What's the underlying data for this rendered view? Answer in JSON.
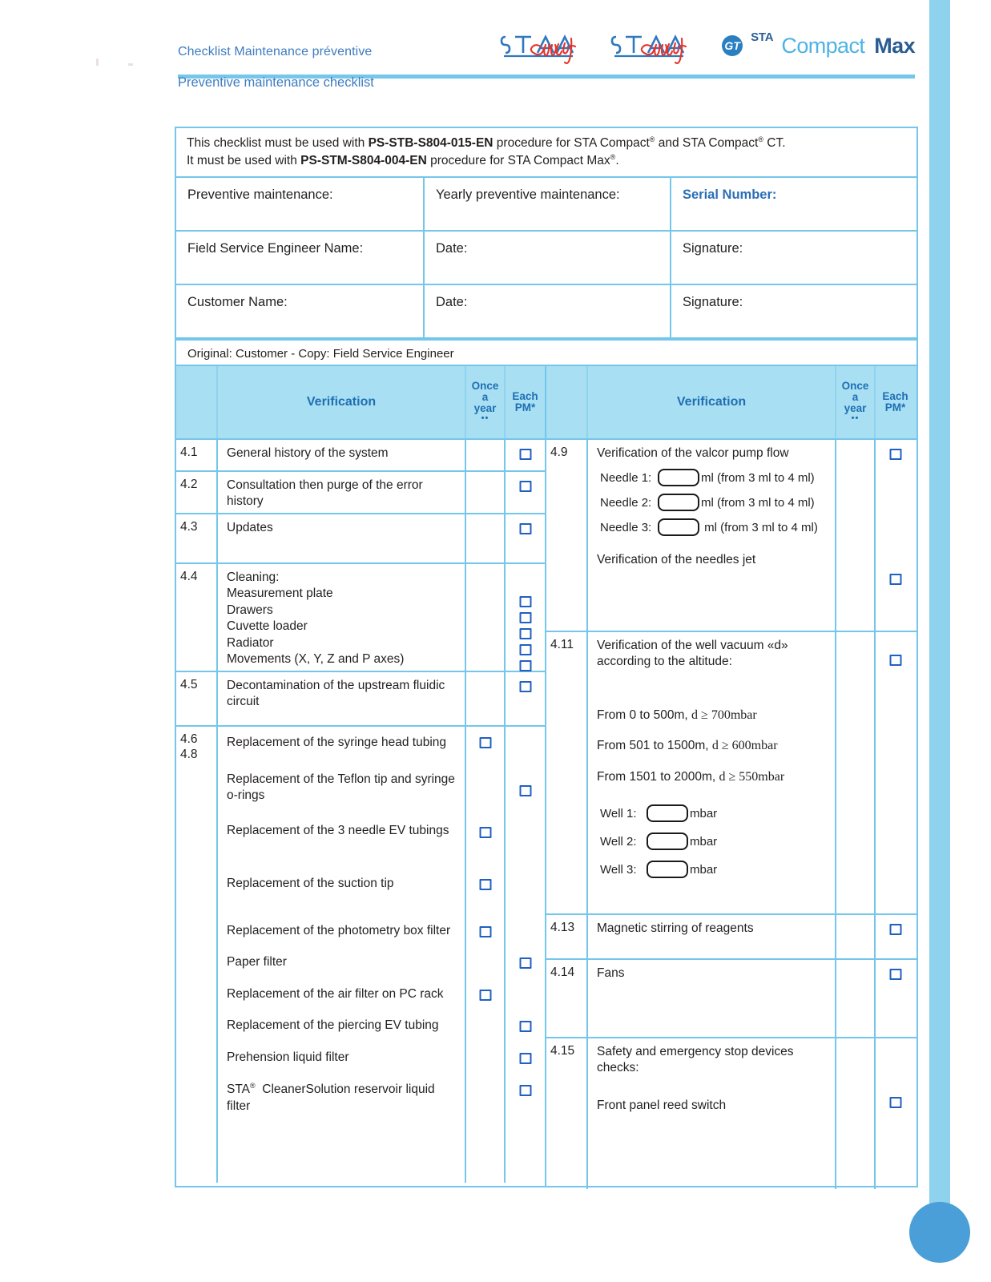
{
  "document": {
    "header": {
      "title_fr": "Checklist Maintenance préventive",
      "title_en": "Preventive maintenance checklist",
      "logo": {
        "mark_text": "STA",
        "mark_script": "Compact",
        "badge_text": "GT",
        "brand_sta": "STA",
        "brand_compact": "Compact",
        "brand_max": "Max"
      }
    },
    "intro": {
      "line1_pre": "This checklist must be used with ",
      "line1_code": "PS-STB-S804-015-EN",
      "line1_mid": " procedure for STA Compact",
      "line1_post": " and STA Compact",
      "line1_end": " CT.",
      "line2_pre": "It must be used with ",
      "line2_code": "PS-STM-S804-004-EN",
      "line2_mid": " procedure for STA Compact Max",
      "line2_end": "."
    },
    "info_table": {
      "rows": [
        {
          "c1": "Preventive maintenance:",
          "c2": "Yearly preventive maintenance:",
          "c3": "Serial Number:",
          "c3_accent": true
        },
        {
          "c1": "Field Service Engineer Name:",
          "c2": "Date:",
          "c3": "Signature:",
          "c3_accent": false
        },
        {
          "c1": "Customer Name:",
          "c2": "Date:",
          "c3": "Signature:",
          "c3_accent": false
        }
      ],
      "footnote": "Original: Customer - Copy: Field Service Engineer"
    },
    "checklist": {
      "columns": {
        "verification": "Verification",
        "once_a_year": {
          "l1": "Once",
          "l2": "a",
          "l3": "year",
          "l4": "••"
        },
        "each_pm": {
          "l1": "Each",
          "l2": "PM*"
        }
      },
      "left_rows": [
        {
          "num": "4.1",
          "lines": [
            "General history of the system"
          ],
          "checks_pm": 1,
          "checks_year": 0
        },
        {
          "num": "4.2",
          "lines": [
            "Consultation then purge of the error",
            "history"
          ],
          "checks_pm": 1,
          "checks_year": 0
        },
        {
          "num": "4.3",
          "lines": [
            "Updates"
          ],
          "checks_pm": 1,
          "checks_year": 0
        },
        {
          "num": "4.4",
          "lines": [
            "Cleaning:",
            "Measurement plate",
            "Drawers",
            "Cuvette loader",
            "Radiator",
            "Movements (X, Y, Z and P axes)"
          ],
          "checks_pm": 5,
          "checks_year": 0
        },
        {
          "num": "4.5",
          "lines": [
            "Decontamination of the upstream fluidic",
            "circuit"
          ],
          "checks_pm": 1,
          "checks_year": 0
        },
        {
          "num": "4.6 / 4.8",
          "num_l1": "4.6",
          "num_l2": "4.8",
          "items": [
            {
              "text": "Replacement of the syringe head tubing",
              "col": "year"
            },
            {
              "text": "Replacement of the Teflon tip and syringe o-rings",
              "col": "pm"
            },
            {
              "text": "Replacement of the 3 needle EV tubings",
              "col": "year"
            },
            {
              "text": "Replacement of the suction tip",
              "col": "year"
            },
            {
              "text": "Replacement of the photometry box filter",
              "col": "year"
            },
            {
              "text": "Paper filter",
              "col": "pm"
            },
            {
              "text": "Replacement of the air filter on PC rack",
              "col": "year"
            },
            {
              "text": "Replacement of the piercing EV tubing",
              "col": "pm"
            },
            {
              "text": "Prehension liquid filter",
              "col": "pm"
            },
            {
              "text": "STA® CleanerSolution reservoir liquid filter",
              "col": "pm"
            }
          ]
        }
      ],
      "right_rows": [
        {
          "num": "4.9",
          "title": "Verification of the valcor pump flow",
          "fields": [
            {
              "label": "Needle 1:",
              "unit": "ml (from 3 ml to 4 ml)"
            },
            {
              "label": "Needle 2:",
              "unit": "ml (from 3 ml to 4 ml)"
            },
            {
              "label": "Needle 3:",
              "unit": "ml (from 3 ml to 4 ml)"
            }
          ],
          "subitem": "Verification of the needles jet"
        },
        {
          "num": "4.11",
          "title_l1": "Verification of the well vacuum «d»",
          "title_l2": "according  to the altitude:",
          "altitudes": [
            {
              "range": "From 0 to 500m,",
              "cond": "d ≥ 700mbar"
            },
            {
              "range": "From 501 to 1500m,",
              "cond": "d ≥ 600mbar"
            },
            {
              "range": "From 1501 to 2000m,",
              "cond": "d ≥ 550mbar"
            }
          ],
          "wells": [
            {
              "label": "Well 1:",
              "unit": "mbar"
            },
            {
              "label": "Well 2:",
              "unit": "mbar"
            },
            {
              "label": "Well 3:",
              "unit": "mbar"
            }
          ]
        },
        {
          "num": "4.13",
          "title": "Magnetic stirring of reagents"
        },
        {
          "num": "4.14",
          "title": "Fans"
        },
        {
          "num": "4.15",
          "title_l1": "Safety and emergency stop devices",
          "title_l2": "checks:",
          "subitem": "Front panel reed switch"
        }
      ]
    }
  },
  "colors": {
    "rule_blue": "#74c6ea",
    "header_fill": "#a9dff3",
    "accent_text": "#2a6fb5",
    "brand_light": "#4eb3e4",
    "brand_dark": "#2a5c94",
    "checkbox_blue": "#2060c0",
    "side_bar": "#8ed2ee",
    "side_dot": "#4a9fd8"
  }
}
